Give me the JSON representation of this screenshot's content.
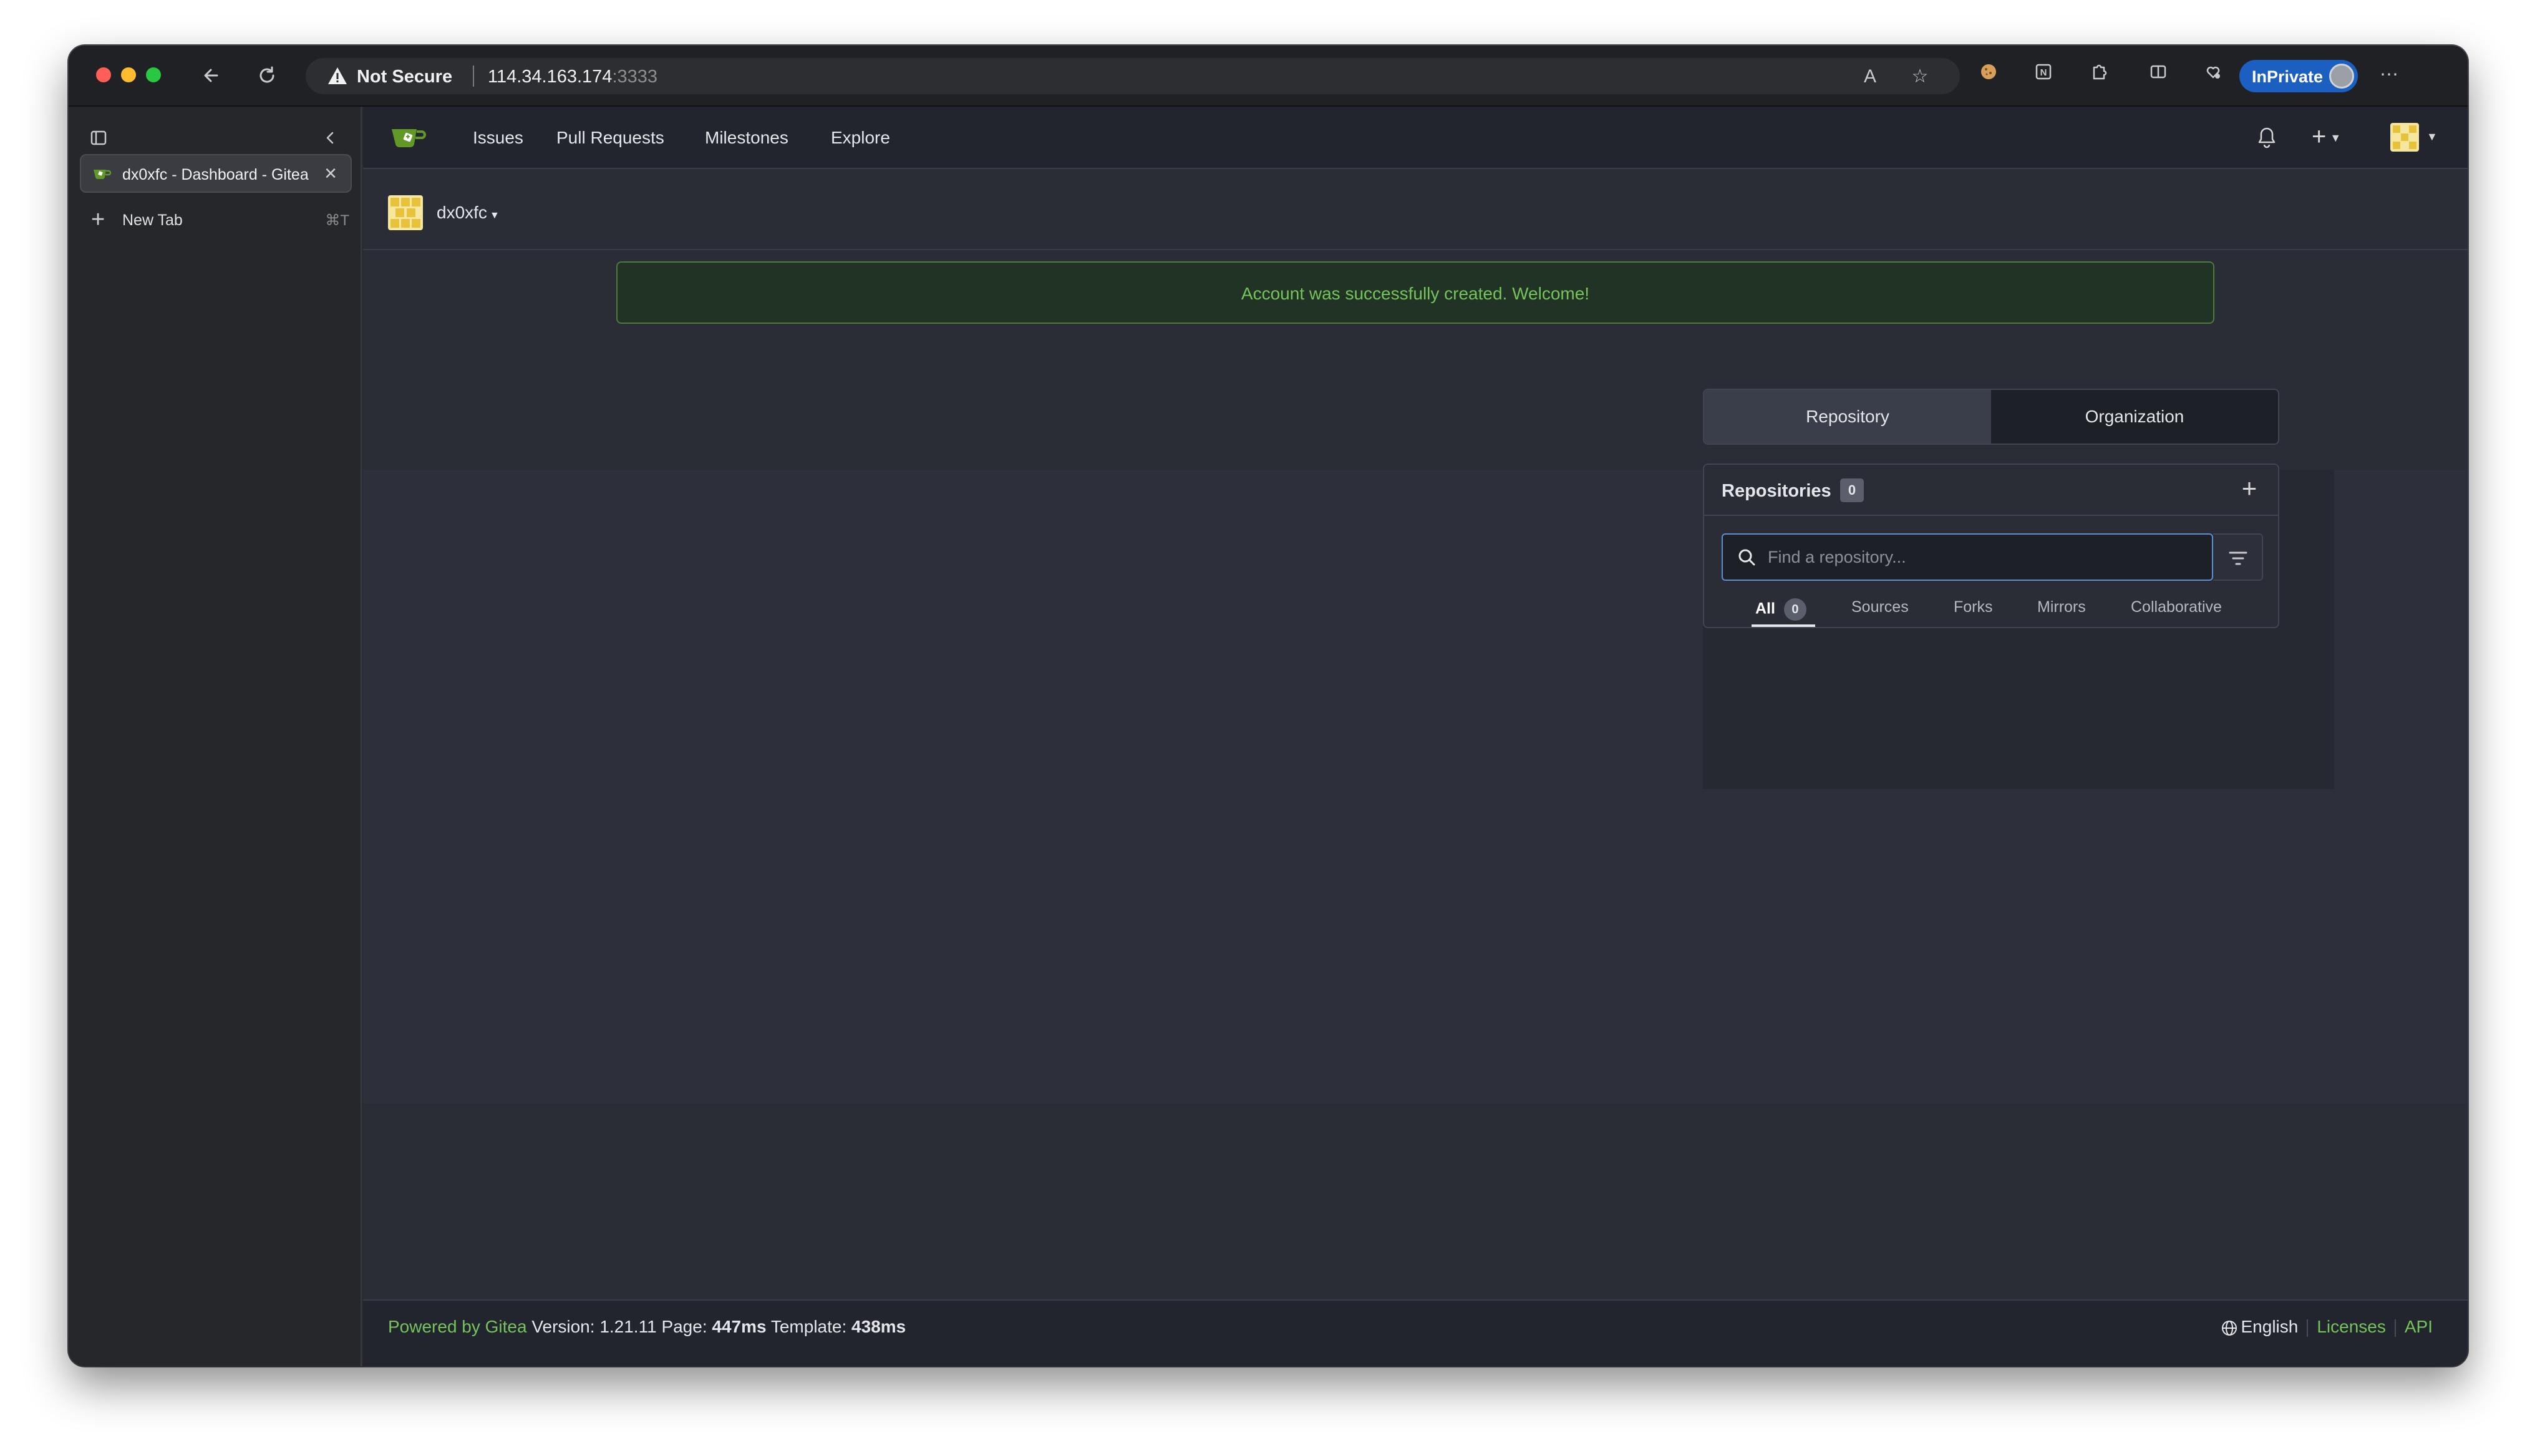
{
  "browser": {
    "security_label": "Not Secure",
    "url_host": "114.34.163.174",
    "url_port": ":3333",
    "inprivate_label": "InPrivate",
    "tab_title": "dx0xfc - Dashboard - Gitea",
    "new_tab_label": "New Tab",
    "new_tab_shortcut": "⌘T"
  },
  "nav": {
    "links": [
      "Issues",
      "Pull Requests",
      "Milestones",
      "Explore"
    ]
  },
  "context": {
    "username": "dx0xfc"
  },
  "flash": {
    "message": "Account was successfully created. Welcome!"
  },
  "switcher": {
    "repository": "Repository",
    "organization": "Organization"
  },
  "repos": {
    "title": "Repositories",
    "count": "0",
    "search_placeholder": "Find a repository...",
    "tabs": {
      "all": "All",
      "all_count": "0",
      "sources": "Sources",
      "forks": "Forks",
      "mirrors": "Mirrors",
      "collaborative": "Collaborative"
    }
  },
  "footer": {
    "powered_by": "Powered by Gitea",
    "version_label": "Version:",
    "version": "1.21.11",
    "page_label": "Page:",
    "page_time": "447ms",
    "template_label": "Template:",
    "template_time": "438ms",
    "language": "English",
    "licenses": "Licenses",
    "api": "API"
  },
  "colors": {
    "accent_green": "#75c35a",
    "inprivate_blue": "#1b5fc1",
    "page_bg": "#2a2d36"
  }
}
